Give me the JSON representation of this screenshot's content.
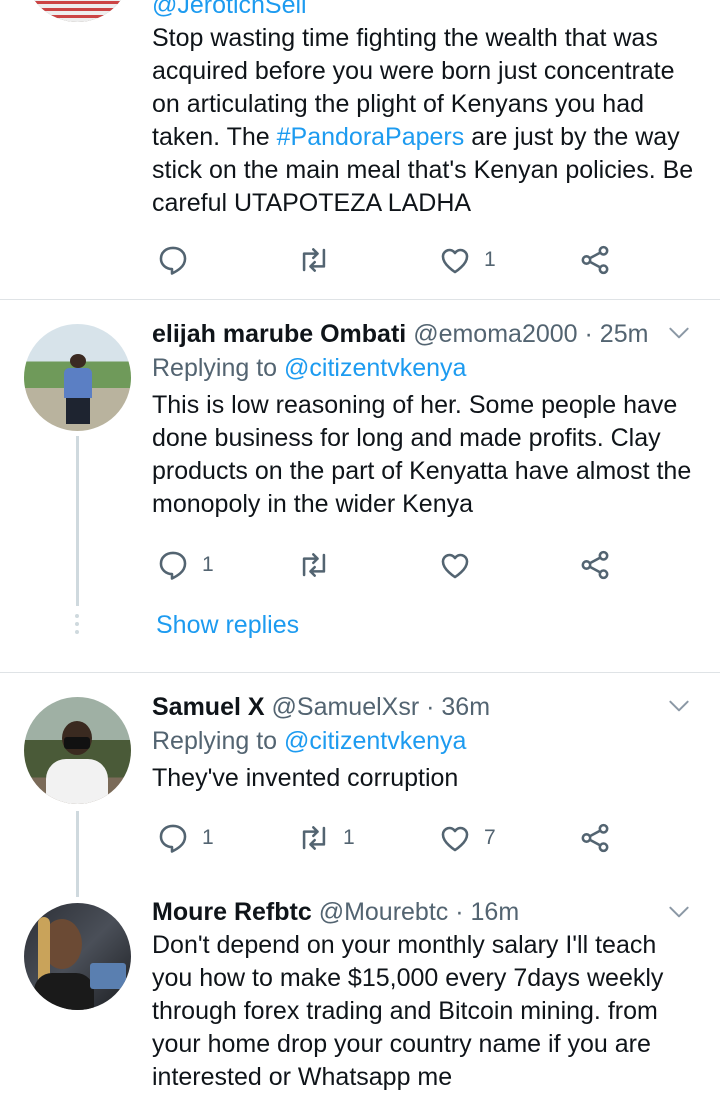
{
  "tweet0": {
    "handle_partial": "@JerotichSeii",
    "text_before": "Stop wasting time fighting the wealth that was acquired before you were born just concentrate on articulating the plight of Kenyans you had taken. The ",
    "hashtag": "#PandoraPapers",
    "text_after": " are just by the way stick on the main meal that's Kenyan policies. Be careful UTAPOTEZA LADHA",
    "reply_count": "",
    "retweet_count": "",
    "like_count": "1"
  },
  "tweet1": {
    "name": "elijah marube Ombati",
    "handle": "@emoma2000",
    "time": "· 25m",
    "replying_prefix": "Replying to",
    "replying_handle": "@citizentvkenya",
    "text": "This is low reasoning of her. Some people have done business for long and made profits. Clay products on the part of Kenyatta have almost the monopoly in the wider Kenya",
    "reply_count": "1",
    "retweet_count": "",
    "like_count": "",
    "show_replies": "Show replies"
  },
  "tweet2": {
    "name": "Samuel X",
    "handle": "@SamuelXsr",
    "time": "· 36m",
    "replying_prefix": "Replying to",
    "replying_handle": "@citizentvkenya",
    "text": "They've invented corruption",
    "reply_count": "1",
    "retweet_count": "1",
    "like_count": "7"
  },
  "tweet3": {
    "name": "Moure Refbtc",
    "handle": "@Mourebtc",
    "time": "· 16m",
    "text": "Don't depend on your monthly salary I'll teach you how to make $15,000 every 7days weekly through forex trading and Bitcoin mining. from your home drop your country name if you are interested or Whatsapp me"
  },
  "colors": {
    "link": "#1d9bf0",
    "secondary": "#536471",
    "primary_text": "#0f1419",
    "divider": "#dfe3e6"
  },
  "icons": [
    "reply-icon",
    "retweet-icon",
    "like-icon",
    "share-icon",
    "caret-down-icon"
  ]
}
